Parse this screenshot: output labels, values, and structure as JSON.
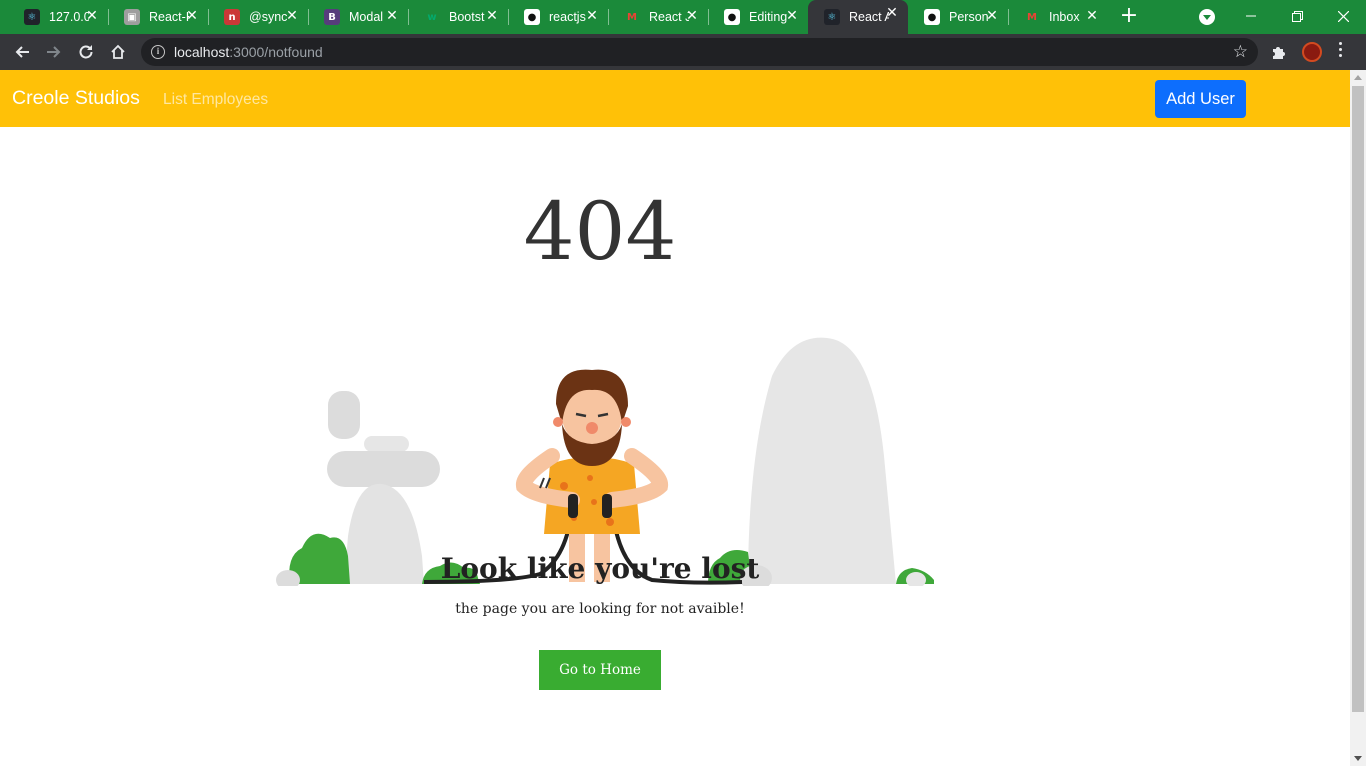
{
  "browser": {
    "tabs": [
      {
        "label": "127.0.0",
        "icon": "react-icon"
      },
      {
        "label": "React-H",
        "icon": "package-icon"
      },
      {
        "label": "@sync",
        "icon": "npm-icon"
      },
      {
        "label": "Modal",
        "icon": "bootstrap-icon"
      },
      {
        "label": "Bootst",
        "icon": "w3-icon"
      },
      {
        "label": "reactjs",
        "icon": "github-icon"
      },
      {
        "label": "React J",
        "icon": "gmail-icon"
      },
      {
        "label": "Editing",
        "icon": "github-icon"
      },
      {
        "label": "React A",
        "icon": "react-icon",
        "active": true
      },
      {
        "label": "Person",
        "icon": "github-icon"
      },
      {
        "label": "Inbox",
        "icon": "gmail-icon"
      }
    ],
    "address": {
      "host": "localhost",
      "path": ":3000/notfound"
    }
  },
  "appnav": {
    "brand": "Creole Studios",
    "link": "List Employees",
    "add_button": "Add User"
  },
  "page": {
    "code": "404",
    "title": "Look like you're lost",
    "subtitle": "the page you are looking for not avaible!",
    "home_button": "Go to Home"
  },
  "colors": {
    "tabstrip": "#1b8a3a",
    "navbar": "#ffc107",
    "primary_button": "#0d6efd",
    "home_button": "#39ac31"
  }
}
